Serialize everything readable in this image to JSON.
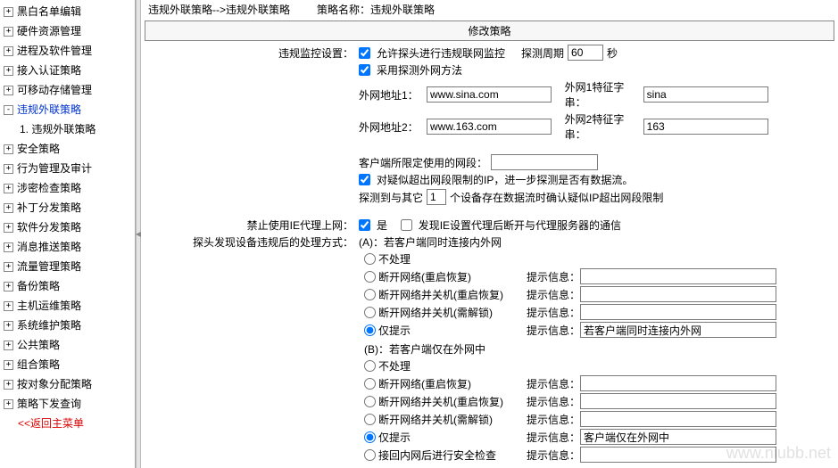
{
  "sidebar": {
    "items": [
      {
        "label": "黑白名单编辑",
        "expandable": true
      },
      {
        "label": "硬件资源管理",
        "expandable": true
      },
      {
        "label": "进程及软件管理",
        "expandable": true
      },
      {
        "label": "接入认证策略",
        "expandable": true
      },
      {
        "label": "可移动存储管理",
        "expandable": true
      },
      {
        "label": "违规外联策略",
        "expandable": true,
        "expanded": true,
        "active": true
      },
      {
        "label": "1. 违规外联策略",
        "sub": true
      },
      {
        "label": "安全策略",
        "expandable": true
      },
      {
        "label": "行为管理及审计",
        "expandable": true
      },
      {
        "label": "涉密检查策略",
        "expandable": true
      },
      {
        "label": "补丁分发策略",
        "expandable": true
      },
      {
        "label": "软件分发策略",
        "expandable": true
      },
      {
        "label": "消息推送策略",
        "expandable": true
      },
      {
        "label": "流量管理策略",
        "expandable": true
      },
      {
        "label": "备份策略",
        "expandable": true
      },
      {
        "label": "主机运维策略",
        "expandable": true
      },
      {
        "label": "系统维护策略",
        "expandable": true
      },
      {
        "label": "公共策略",
        "expandable": true
      },
      {
        "label": "组合策略",
        "expandable": true
      },
      {
        "label": "按对象分配策略",
        "expandable": true
      },
      {
        "label": "策略下发查询",
        "expandable": true
      }
    ],
    "return_label": "<<返回主菜单"
  },
  "header": {
    "breadcrumb": "违规外联策略-->违规外联策略",
    "policy_name_label": "策略名称：",
    "policy_name": "违规外联策略",
    "panel_title": "修改策略"
  },
  "form": {
    "monitor_label": "违规监控设置：",
    "allow_probe": "允许探头进行违规联网监控",
    "probe_period_label": "探测周期",
    "probe_period_value": "60",
    "probe_period_unit": "秒",
    "detect_method": "采用探测外网方法",
    "addr1_label": "外网地址1：",
    "addr1_value": "www.sina.com",
    "feat1_label": "外网1特征字串：",
    "feat1_value": "sina",
    "addr2_label": "外网地址2：",
    "addr2_value": "www.163.com",
    "feat2_label": "外网2特征字串：",
    "feat2_value": "163",
    "client_seg_label": "客户端所限定使用的网段：",
    "suspect_probe": "对疑似超出网段限制的IP，进一步探测是否有数据流。",
    "confirm_prefix": "探测到与其它",
    "confirm_count": "1",
    "confirm_suffix": "个设备存在数据流时确认疑似IP超出网段限制",
    "ie_proxy_label": "禁止使用IE代理上网：",
    "ie_yes": "是",
    "ie_proxy_disc": "发现IE设置代理后断开与代理服务器的通信",
    "violation_action_label": "探头发现设备违规后的处理方式：",
    "scenario_a": "(A)：若客户端同时连接内外网",
    "scenario_b": "(B)：若客户端仅在外网中",
    "opts": {
      "none": "不处理",
      "disc_restore": "断开网络(重启恢复)",
      "disc_shut_restore": "断开网络并关机(重启恢复)",
      "disc_shut_unlock": "断开网络并关机(需解锁)",
      "hint_only": "仅提示",
      "accept_sec": "接回内网后进行安全检查"
    },
    "hint_label": "提示信息：",
    "hint_a_value": "若客户端同时连接内外网",
    "hint_b_value": "客户端仅在外网中"
  },
  "watermark": "www.niubb.net"
}
